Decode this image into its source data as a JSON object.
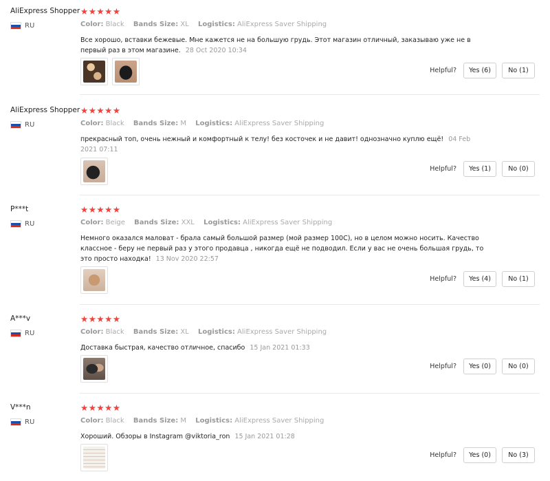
{
  "labels": {
    "color": "Color:",
    "bands_size": "Bands Size:",
    "logistics": "Logistics:",
    "helpful": "Helpful?"
  },
  "stars": "★★★★★",
  "reviews": [
    {
      "user": "AliExpress Shopper",
      "country": "RU",
      "color": "Black",
      "bands_size": "XL",
      "logistics": "AliExpress Saver Shipping",
      "text": "Все хорошо, вставки бежевые. Мне кажется не на большую грудь. Этот магазин отличный, заказываю уже не в первый раз в этом магазине.",
      "date": "28 Oct 2020 10:34",
      "yes": "Yes (6)",
      "no": "No (1)"
    },
    {
      "user": "AliExpress Shopper",
      "country": "RU",
      "color": "Black",
      "bands_size": "M",
      "logistics": "AliExpress Saver Shipping",
      "text": "прекрасный топ, очень нежный и комфортный к телу! без косточек и не давит! однозначно куплю ещё!",
      "date": "04 Feb 2021 07:11",
      "yes": "Yes (1)",
      "no": "No (0)"
    },
    {
      "user": "P***t",
      "country": "RU",
      "color": "Beige",
      "bands_size": "XXL",
      "logistics": "AliExpress Saver Shipping",
      "text": "Немного оказался маловат - брала самый большой размер (мой размер 100С), но в целом можно носить. Качество классное - беру не первый раз у этого продавца , никогда ещё не подводил. Если у вас не очень большая грудь, то это просто находка!",
      "date": "13 Nov 2020 22:57",
      "yes": "Yes (4)",
      "no": "No (1)"
    },
    {
      "user": "A***v",
      "country": "RU",
      "color": "Black",
      "bands_size": "XL",
      "logistics": "AliExpress Saver Shipping",
      "text": "Доставка быстрая, качество отличное, спасибо",
      "date": "15 Jan 2021 01:33",
      "yes": "Yes (0)",
      "no": "No (0)"
    },
    {
      "user": "V***n",
      "country": "RU",
      "color": "Black",
      "bands_size": "M",
      "logistics": "AliExpress Saver Shipping",
      "text": "Хороший. Обзоры в Instagram @viktoria_ron",
      "date": "15 Jan 2021 01:28",
      "yes": "Yes (0)",
      "no": "No (3)"
    }
  ]
}
